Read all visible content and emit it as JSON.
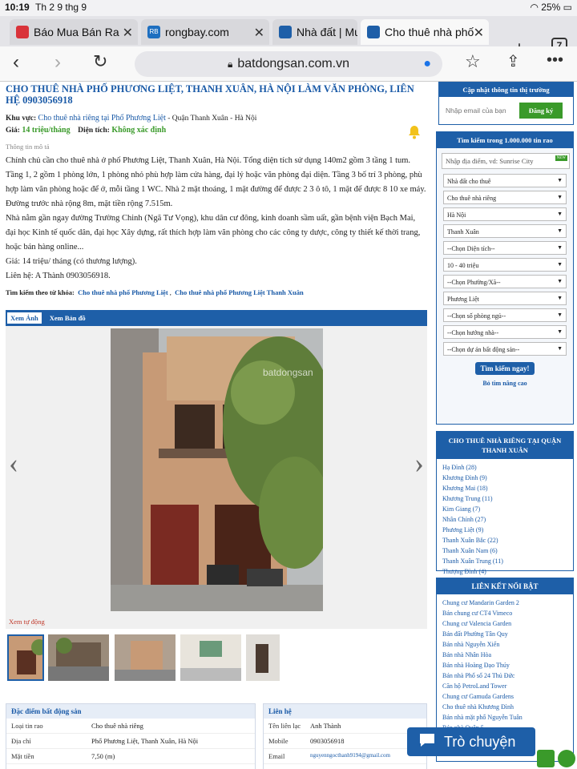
{
  "status": {
    "time": "10:19",
    "date": "Th 2 9 thg 9",
    "battery": "25%"
  },
  "tabs": [
    {
      "label": "Báo Mua Bán Ra",
      "color": "#d9333a"
    },
    {
      "label": "rongbay.com",
      "color": "#1e6fc0"
    },
    {
      "label": "Nhà đất | Mu",
      "color": "#1e5fa8"
    },
    {
      "label": "Cho thuê nhà phố",
      "color": "#1e5fa8"
    }
  ],
  "tab_count": "7",
  "url": "batdongsan.com.vn",
  "listing": {
    "title": "CHO THUÊ NHÀ PHỐ PHƯƠNG LIỆT, THANH XUÂN, HÀ NỘI LÀM VĂN PHÒNG, LIÊN HỆ 0903056918",
    "area_label": "Khu vực:",
    "area_link": "Cho thuê nhà riêng tại Phố Phương Liệt",
    "area_suffix": " - Quận Thanh Xuân - Hà Nội",
    "price_label": "Giá:",
    "price": "14 triệu/tháng",
    "size_label": "Diện tích:",
    "size": "Không xác định",
    "desc_heading": "Thông tin mô tả",
    "desc": [
      "Chính chủ cần cho thuê nhà ở phố Phương Liệt, Thanh Xuân, Hà Nội. Tổng diện tích sử dụng 140m2 gồm 3 tầng 1 tum. Tầng 1, 2 gồm 1 phòng lớn, 1 phòng nhỏ phù hợp làm cửa hàng, đại lý hoặc văn phòng đại diện. Tầng 3 bố trí 3 phòng, phù hợp làm văn phòng hoặc để ở, mỗi tầng 1 WC. Nhà 2 mặt thoáng, 1 mặt đường để được 2 3 ô tô, 1 mặt để được 8 10 xe máy. Đường trước nhà rộng 8m, mặt tiền rộng 7.515m.",
      "Nhà nằm gần ngay đường Trường Chinh (Ngã Tư Vọng), khu dân cư đông, kinh doanh sầm uất, gần bệnh viện Bạch Mai, đại học Kinh tế quốc dân, đại học Xây dựng, rất thích hợp làm văn phòng cho các công ty dược, công ty thiết kế thời trang, hoặc bán hàng online...",
      "Giá: 14 triệu/ tháng (có thương lượng).",
      "Liên hệ: A Thành 0903056918."
    ],
    "kw_label": "Tìm kiếm theo từ khóa:",
    "kw1": "Cho thuê nhà phố Phương Liệt",
    "kw2": "Cho thuê nhà phố Phương Liệt Thanh Xuân",
    "tab_photo": "Xem Ảnh",
    "tab_map": "Xem Bản đồ",
    "watermark": "batdongsan",
    "auto_label": "Xem tự động",
    "features_heading": "Đặc điểm bất động sản",
    "features": [
      {
        "k": "Loại tin rao",
        "v": "Cho thuê nhà riêng"
      },
      {
        "k": "Địa chỉ",
        "v": "Phố Phương Liệt, Thanh Xuân, Hà Nội"
      },
      {
        "k": "Mặt tiền",
        "v": "7,50 (m)"
      }
    ],
    "contact_heading": "Liên hệ",
    "contact": [
      {
        "k": "Tên liên lạc",
        "v": "Anh Thành"
      },
      {
        "k": "Mobile",
        "v": "0903056918"
      },
      {
        "k": "Email",
        "v": "nguyenngocthanh9194@gmail.com"
      }
    ]
  },
  "sidebar": {
    "subscribe_heading": "Cập nhật thông tin thị trường",
    "email_placeholder": "Nhập email của bạn",
    "subscribe_button": "Đăng ký",
    "search_heading": "Tìm kiếm trong 1.000.000 tin rao",
    "search_placeholder": "Nhập địa điểm, vd: Sunrise City",
    "new_badge": "NEW",
    "selects": [
      "Nhà đất cho thuê",
      "Cho thuê nhà riêng",
      "Hà Nội",
      "Thanh Xuân",
      "--Chọn Diện tích--",
      "10 - 40 triệu",
      "--Chọn Phường/Xã--",
      "Phương Liệt",
      "--Chọn số phòng ngủ--",
      "--Chọn hướng nhà--",
      "--Chọn dự án bất động sản--"
    ],
    "search_button": "Tìm kiếm ngay!",
    "advanced": "Bỏ tìm nâng cao",
    "district_heading": "CHO THUÊ NHÀ RIÊNG TẠI QUẬN THANH XUÂN",
    "districts": [
      "Hạ Đình (28)",
      "Khương Đình (9)",
      "Khương Mai (18)",
      "Khương Trung (11)",
      "Kim Giang (7)",
      "Nhân Chính (27)",
      "Phương Liệt (9)",
      "Thanh Xuân Bắc (22)",
      "Thanh Xuân Nam (6)",
      "Thanh Xuân Trung (11)",
      "Thượng Đình (4)"
    ],
    "links_heading": "LIÊN KẾT NỔI BẬT",
    "links": [
      "Chung cư Mandarin Garden 2",
      "Bán chung cư CT4 Vimeco",
      "Chung cư Valencia Garden",
      "Bán đất Phường Tân Quy",
      "Bán nhà Nguyễn Xiển",
      "Bán nhà Nhân Hòa",
      "Bán nhà Hoàng Đạo Thúy",
      "Bán nhà Phố số 24 Thủ Đức",
      "Căn hộ PetroLand Tower",
      "Chung cư Gamuda Gardens",
      "Cho thuê nhà Khương Đình",
      "Bán nhà mặt phố Nguyễn Tuân",
      "Bán nhà Quận 5"
    ]
  },
  "chat_label": "Trò chuyện"
}
